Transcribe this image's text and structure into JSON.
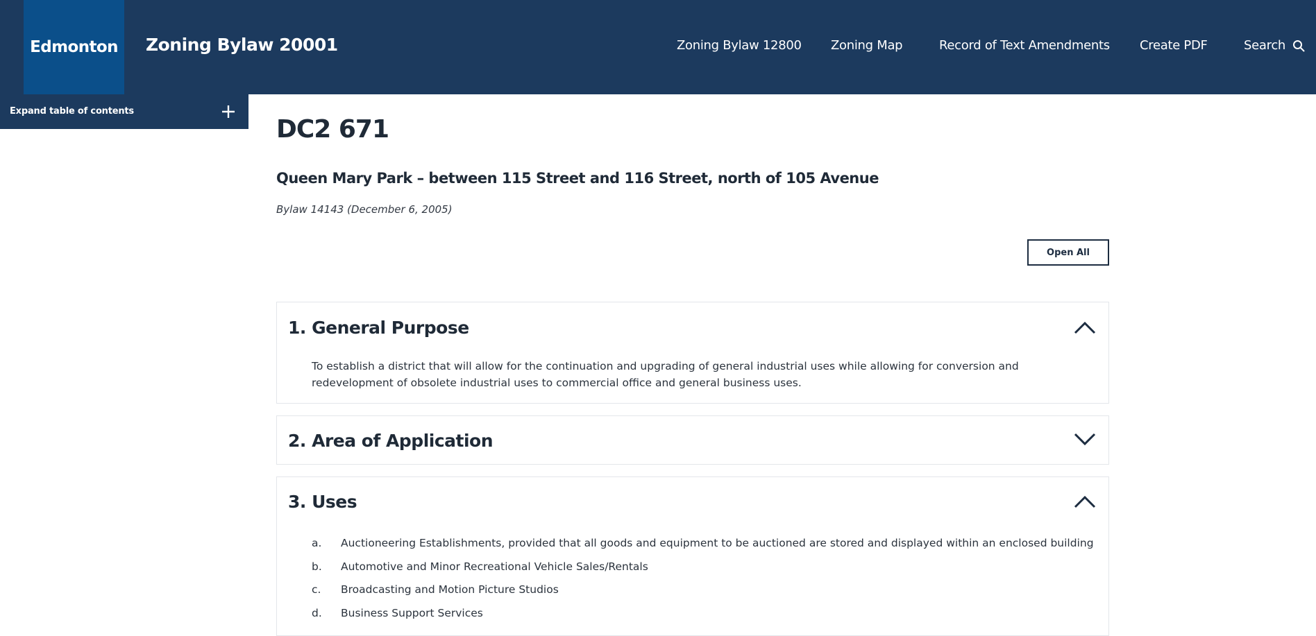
{
  "header": {
    "logo_text": "Edmonton",
    "site_title": "Zoning Bylaw 20001",
    "nav": [
      {
        "label": "Zoning Bylaw 12800"
      },
      {
        "label": "Zoning Map"
      },
      {
        "label": "Record of Text Amendments"
      },
      {
        "label": "Create PDF"
      },
      {
        "label": "Search"
      }
    ],
    "icons": {
      "search": "search-icon"
    }
  },
  "toc": {
    "label": "Expand table of contents",
    "icon": "plus-icon"
  },
  "main": {
    "title": "DC2 671",
    "subtitle": "Queen Mary Park – between 115 Street and 116 Street, north of 105 Avenue",
    "bylaw_ref": "Bylaw 14143 (December 6, 2005)",
    "open_all_label": "Open All",
    "sections": [
      {
        "heading": "1. General Purpose",
        "expanded": true,
        "body": "To establish a district that will allow for the continuation and upgrading of general industrial uses while allowing for conversion and redevelopment of obsolete industrial uses to commercial office and general business uses."
      },
      {
        "heading": "2. Area of Application",
        "expanded": false
      },
      {
        "heading": "3. Uses",
        "expanded": true,
        "items": [
          {
            "letter": "a.",
            "text": "Auctioneering Establishments, provided that all goods and equipment to be auctioned are stored and displayed within an enclosed building"
          },
          {
            "letter": "b.",
            "text": "Automotive and Minor Recreational Vehicle Sales/Rentals"
          },
          {
            "letter": "c.",
            "text": "Broadcasting and Motion Picture Studios"
          },
          {
            "letter": "d.",
            "text": "Business Support Services"
          }
        ]
      }
    ]
  },
  "colors": {
    "header_bg": "#1c3a5e",
    "logo_bg": "#0b4f8a",
    "text": "#1f2a37",
    "panel_border": "#e3e6ea"
  }
}
